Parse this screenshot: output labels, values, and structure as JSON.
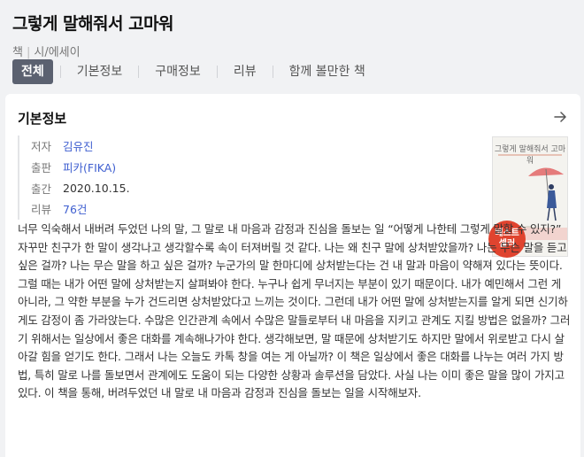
{
  "book": {
    "title": "그렇게 말해줘서 고마워",
    "category": [
      "책",
      "시/에세이"
    ]
  },
  "tabs": [
    {
      "label": "전체",
      "active": true
    },
    {
      "label": "기본정보",
      "active": false
    },
    {
      "label": "구매정보",
      "active": false
    },
    {
      "label": "리뷰",
      "active": false
    },
    {
      "label": "함께 볼만한 책",
      "active": false
    }
  ],
  "basic_info": {
    "heading": "기본정보",
    "rows": [
      {
        "label": "저자",
        "value": "김유진"
      },
      {
        "label": "출판",
        "value": "피카(FIKA)"
      },
      {
        "label": "출간",
        "value": "2020.10.15."
      },
      {
        "label": "리뷰",
        "value": "76건"
      }
    ],
    "cover": {
      "title_text": "그렇게 말해줘서 고마워",
      "badge": "베스트\n셀러"
    },
    "description": "너무 익숙해서 내버려 두었던 나의 말, 그 말로 내 마음과 감정과 진심을 돌보는 일 “어떻게 나한테 그렇게 말할 수 있지?” 자꾸만 친구가 한 말이 생각나고 생각할수록 속이 터져버릴 것 같다. 나는 왜 친구 말에 상처받았을까? 나는 무슨 말을 듣고 싶은 걸까? 나는 무슨 말을 하고 싶은 걸까? 누군가의 말 한마디에 상처받는다는 건 내 말과 마음이 약해져 있다는 뜻이다. 그럴 때는 내가 어떤 말에 상처받는지 살펴봐야 한다. 누구나 쉽게 무너지는 부분이 있기 때문이다. 내가 예민해서 그런 게 아니라, 그 약한 부분을 누가 건드리면 상처받았다고 느끼는 것이다. 그런데 내가 어떤 말에 상처받는지를 알게 되면 신기하게도 감정이 좀 가라앉는다. 수많은 인간관계 속에서 수많은 말들로부터 내 마음을 지키고 관계도 지킬 방법은 없을까? 그러기 위해서는 일상에서 좋은 대화를 계속해나가야 한다. 생각해보면, 말 때문에 상처받기도 하지만 말에서 위로받고 다시 살아갈 힘을 얻기도 한다. 그래서 나는 오늘도 카톡 창을 여는 게 아닐까? 이 책은 일상에서 좋은 대화를 나누는 여러 가지 방법, 특히 말로 나를 돌보면서 관계에도 도움이 되는 다양한 상황과 솔루션을 담았다. 사실 나는 이미 좋은 말을 많이 가지고 있다. 이 책을 통해, 버려두었던 내 말로 내 마음과 감정과 진심을 돌보는 일을 시작해보자."
  }
}
